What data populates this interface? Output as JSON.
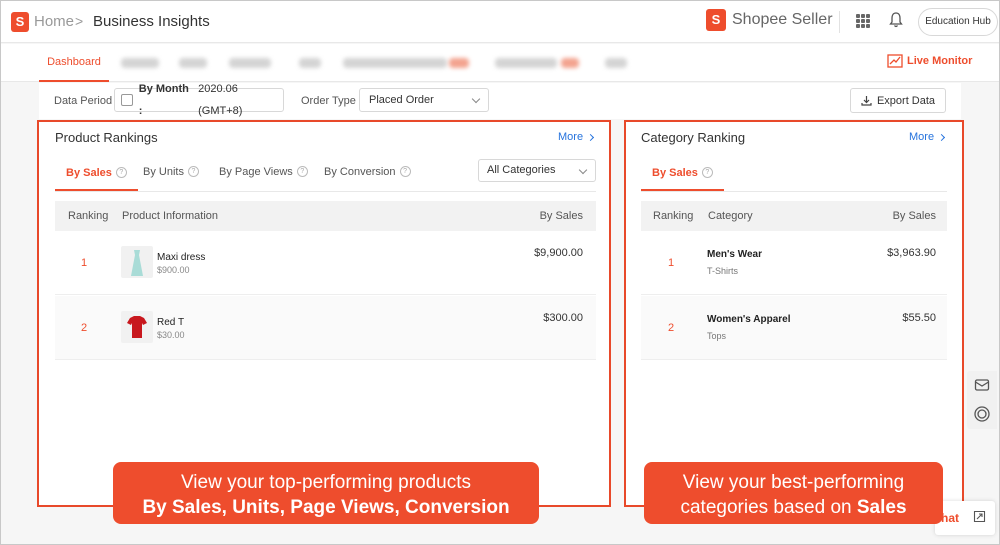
{
  "header": {
    "logo_letter": "S",
    "home_label": "Home",
    "separator": ">",
    "page_title": "Business Insights",
    "brand": "Shopee Seller",
    "edu_button": "Education Hub",
    "grid_icon": "apps-grid-icon",
    "bell_icon": "bell-icon"
  },
  "nav": {
    "active_tab": "Dashboard",
    "live_monitor": "Live Monitor",
    "live_icon": "trend-chart-icon"
  },
  "filters": {
    "period_label": "Data Period",
    "period_mode": "By Month :",
    "period_value": "2020.06 (GMT+8)",
    "order_type_label": "Order Type",
    "order_type_value": "Placed Order",
    "export_label": "Export Data"
  },
  "product_rankings": {
    "title": "Product Rankings",
    "more": "More",
    "tabs": [
      "By Sales",
      "By Units",
      "By Page Views",
      "By Conversion"
    ],
    "category_filter": "All Categories",
    "columns": [
      "Ranking",
      "Product Information",
      "By Sales"
    ],
    "rows": [
      {
        "rank": "1",
        "name": "Maxi dress",
        "price": "$900.00",
        "sales": "$9,900.00"
      },
      {
        "rank": "2",
        "name": "Red T",
        "price": "$30.00",
        "sales": "$300.00"
      }
    ]
  },
  "category_ranking": {
    "title": "Category Ranking",
    "more": "More",
    "tabs": [
      "By Sales"
    ],
    "columns": [
      "Ranking",
      "Category",
      "By Sales"
    ],
    "rows": [
      {
        "rank": "1",
        "name": "Men's Wear",
        "sub": "T-Shirts",
        "sales": "$3,963.90"
      },
      {
        "rank": "2",
        "name": "Women's Apparel",
        "sub": "Tops",
        "sales": "$55.50"
      }
    ]
  },
  "callouts": {
    "left_line1": "View your top-performing products",
    "left_line2": "By Sales, Units, Page Views, Conversion",
    "right_line1": "View your best-performing",
    "right_line2a": "categories based on ",
    "right_line2b": "Sales"
  },
  "floating": {
    "chat_label": "hat"
  },
  "colors": {
    "accent": "#ee4d2d",
    "link": "#2673dd",
    "highlight_border": "#e8492a"
  }
}
